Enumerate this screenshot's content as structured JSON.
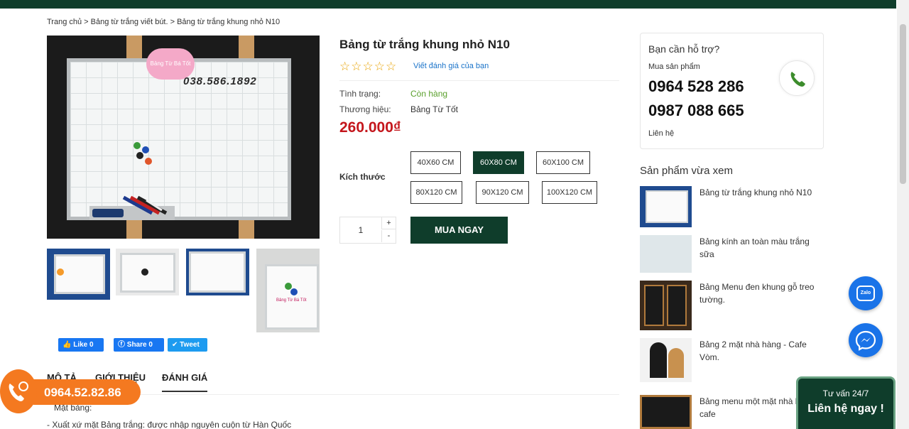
{
  "breadcrumb": {
    "home": "Trang chủ",
    "sep1": " > ",
    "category": "Bảng từ trắng viết bút.",
    "sep2": " > ",
    "current": "Bảng từ trắng khung nhỏ N10"
  },
  "gallery": {
    "main_phone": "038.586.1892",
    "main_badge": "Bảng Từ Bá Tốt",
    "thumb4_caption": "Bảng Từ Bá Tốt"
  },
  "social": {
    "like": "Like 0",
    "share": "Share 0",
    "tweet": "Tweet"
  },
  "tabs": {
    "description": "MÔ TẢ",
    "introduction": "GIỚI THIỆU",
    "review": "ĐÁNH GIÁ"
  },
  "description": {
    "line1": "Mặt bảng:",
    "line2": "- Xuất xứ mặt Bảng trắng: được nhập nguyên cuộn từ Hàn Quốc"
  },
  "product": {
    "title": "Bảng từ trắng khung nhỏ N10",
    "stars": "☆☆☆☆☆",
    "review_link": "Viết đánh giá của bạn",
    "status_label": "Tình trạng:",
    "status_value": "Còn hàng",
    "brand_label": "Thương hiệu:",
    "brand_value": "Bảng Từ Tốt",
    "price": "260.000₫",
    "size_label": "Kích thước",
    "sizes": [
      "40X60 CM",
      "60X80 CM",
      "60X100 CM",
      "80X120 CM",
      "90X120 CM",
      "100X120 CM"
    ],
    "selected_size": "60X80 CM",
    "quantity": "1",
    "plus": "+",
    "minus": "-",
    "buy_label": "MUA NGAY"
  },
  "support": {
    "heading": "Bạn cần hỗ trợ?",
    "sub": "Mua sản phẩm",
    "phone1": "0964 528 286",
    "phone2": "0987 088 665",
    "contact": "Liên hệ"
  },
  "recent": {
    "heading": "Sản phẩm vừa xem",
    "items": [
      "Bảng từ trắng khung nhỏ N10",
      "Bảng kính an toàn màu trắng sữa",
      "Bảng Menu đen khung gỗ treo tường.",
      "Bảng 2 mặt nhà hàng - Cafe Vòm.",
      "Bảng menu một mặt nhà hàng-cafe"
    ]
  },
  "floating": {
    "zalo": "Zalo",
    "consult_small": "Tư vấn 24/7",
    "consult_big": "Liên hệ ngay !",
    "hotline": "0964.52.82.86"
  },
  "colors": {
    "brand_green": "#0f3d2b",
    "price_red": "#c4161c",
    "status_green": "#5aa02c",
    "star": "#e8a200",
    "hotline_orange": "#f47920",
    "fab_blue": "#1a73e8"
  }
}
